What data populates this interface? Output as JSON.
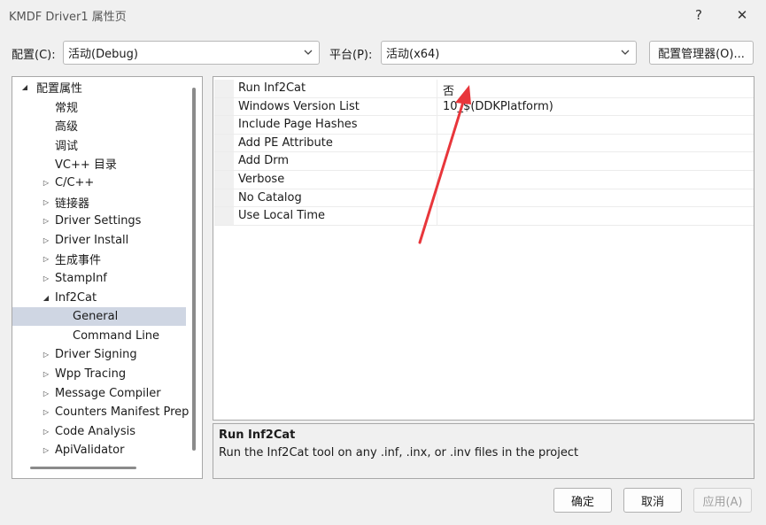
{
  "window": {
    "title": "KMDF Driver1 属性页",
    "help_glyph": "?",
    "close_glyph": "✕"
  },
  "config": {
    "config_label": "配置(C):",
    "config_value": "活动(Debug)",
    "platform_label": "平台(P):",
    "platform_value": "活动(x64)",
    "manager_button": "配置管理器(O)..."
  },
  "tree": {
    "items": [
      {
        "label": "配置属性",
        "arrow": "◢",
        "level": 0
      },
      {
        "label": "常规",
        "arrow": "",
        "level": 1
      },
      {
        "label": "高级",
        "arrow": "",
        "level": 1
      },
      {
        "label": "调试",
        "arrow": "",
        "level": 1
      },
      {
        "label": "VC++ 目录",
        "arrow": "",
        "level": 1
      },
      {
        "label": "C/C++",
        "arrow": "▷",
        "level": 1
      },
      {
        "label": "链接器",
        "arrow": "▷",
        "level": 1
      },
      {
        "label": "Driver Settings",
        "arrow": "▷",
        "level": 1
      },
      {
        "label": "Driver Install",
        "arrow": "▷",
        "level": 1
      },
      {
        "label": "生成事件",
        "arrow": "▷",
        "level": 1
      },
      {
        "label": "StampInf",
        "arrow": "▷",
        "level": 1
      },
      {
        "label": "Inf2Cat",
        "arrow": "◢",
        "level": 1
      },
      {
        "label": "General",
        "arrow": "",
        "level": 2,
        "selected": true
      },
      {
        "label": "Command Line",
        "arrow": "",
        "level": 2
      },
      {
        "label": "Driver Signing",
        "arrow": "▷",
        "level": 1
      },
      {
        "label": "Wpp Tracing",
        "arrow": "▷",
        "level": 1
      },
      {
        "label": "Message Compiler",
        "arrow": "▷",
        "level": 1
      },
      {
        "label": "Counters Manifest Prep",
        "arrow": "▷",
        "level": 1
      },
      {
        "label": "Code Analysis",
        "arrow": "▷",
        "level": 1
      },
      {
        "label": "ApiValidator",
        "arrow": "▷",
        "level": 1
      }
    ]
  },
  "properties": [
    {
      "name": "Run Inf2Cat",
      "value": "否"
    },
    {
      "name": "Windows Version List",
      "value": "10_$(DDKPlatform)"
    },
    {
      "name": "Include Page Hashes",
      "value": ""
    },
    {
      "name": "Add PE Attribute",
      "value": ""
    },
    {
      "name": "Add Drm",
      "value": ""
    },
    {
      "name": "Verbose",
      "value": ""
    },
    {
      "name": "No Catalog",
      "value": ""
    },
    {
      "name": "Use Local Time",
      "value": ""
    }
  ],
  "description": {
    "title": "Run Inf2Cat",
    "text": "Run the Inf2Cat tool on any .inf, .inx, or .inv files in the project"
  },
  "buttons": {
    "ok": "确定",
    "cancel": "取消",
    "apply": "应用(A)"
  },
  "colors": {
    "annotation_arrow": "#e8363b",
    "selection": "#cfd6e3"
  }
}
